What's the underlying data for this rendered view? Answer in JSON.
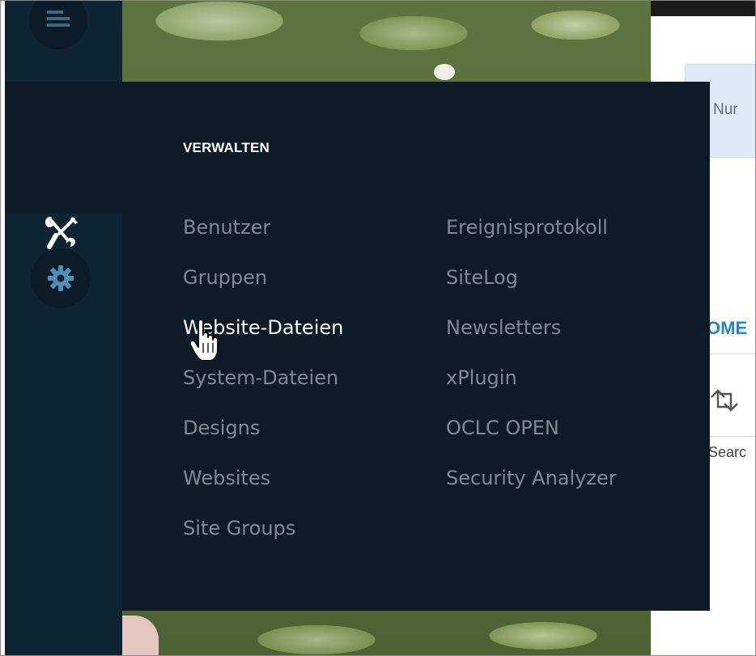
{
  "menu": {
    "title": "VERWALTEN",
    "columns": [
      [
        "Benutzer",
        "Gruppen",
        "Website-Dateien",
        "System-Dateien",
        "Designs",
        "Websites",
        "Site Groups"
      ],
      [
        "Ereignisprotokoll",
        "SiteLog",
        "Newsletters",
        "xPlugin",
        "OCLC OPEN",
        "Security Analyzer"
      ]
    ],
    "hovered_item": "Website-Dateien"
  },
  "sidebar": {
    "icons": [
      "page-list-icon",
      "tools-icon",
      "gear-icon"
    ]
  },
  "right_panel": {
    "info_text": "Nur",
    "home_text": "OME",
    "search_text": "Searc"
  },
  "colors": {
    "sidebar_bg": "#0f2433",
    "flyout_bg": "#0c1b25",
    "menu_item": "#7f8b93",
    "menu_item_active": "#ffffff",
    "link_blue": "#2a85c4"
  }
}
